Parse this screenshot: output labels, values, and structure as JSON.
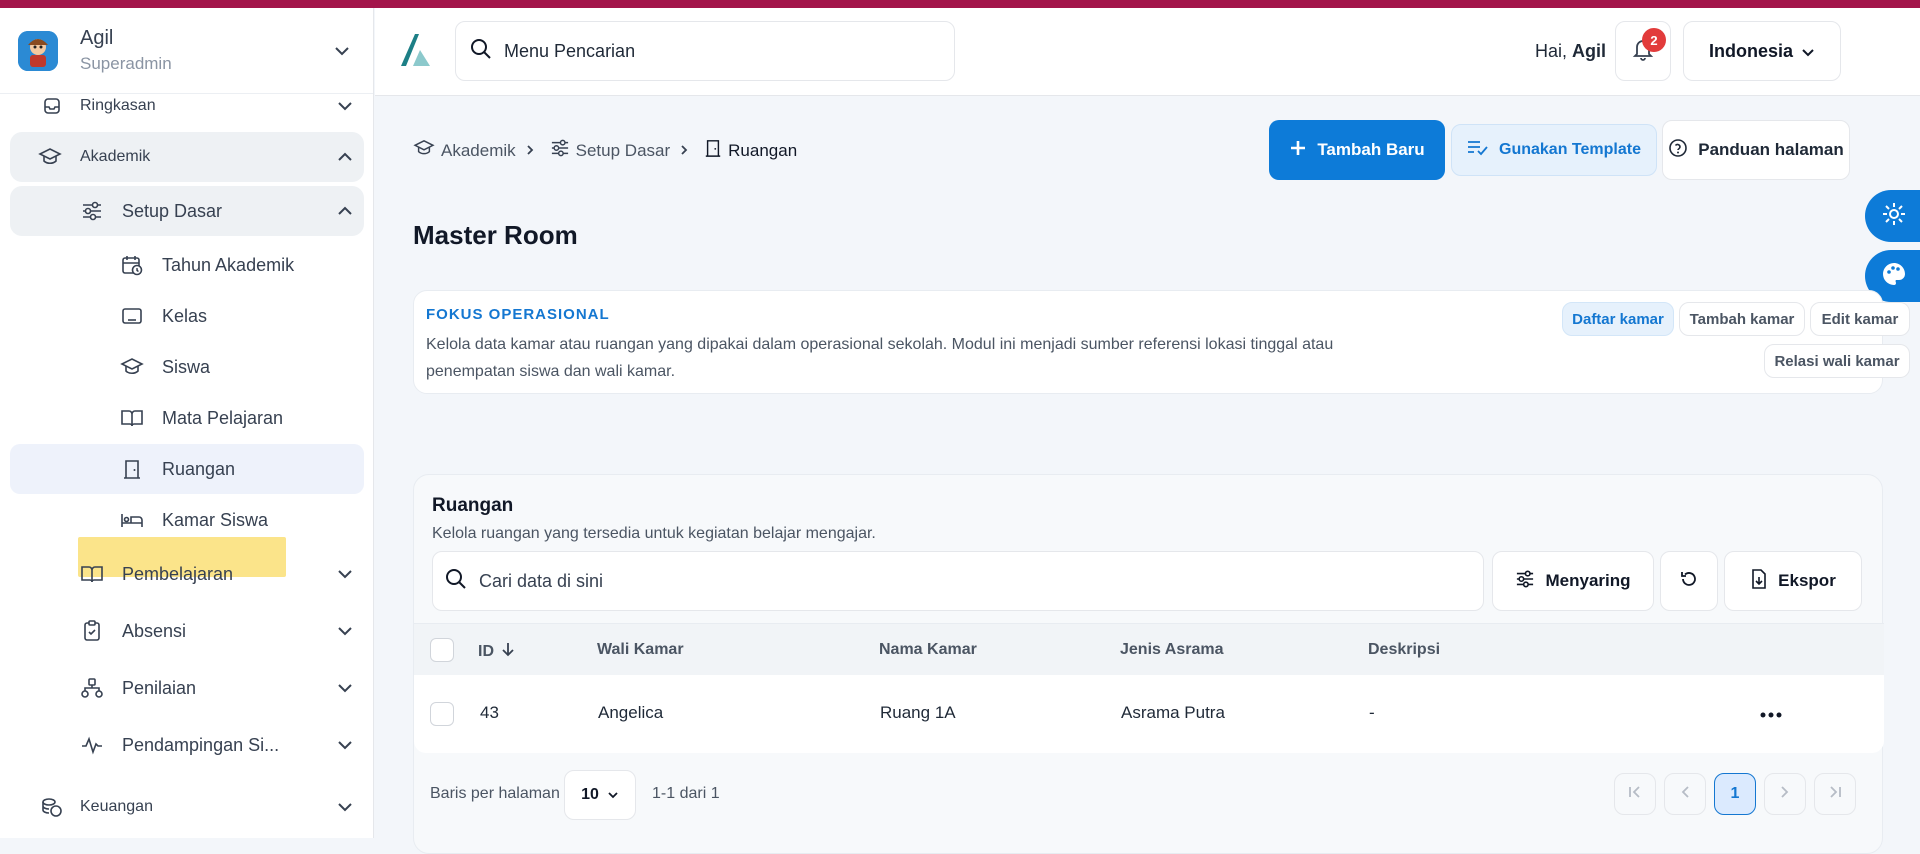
{
  "user": {
    "name": "Agil",
    "role": "Superadmin"
  },
  "sidebar": {
    "items": [
      {
        "label": "Ringkasan"
      },
      {
        "label": "Akademik"
      },
      {
        "label": "Setup Dasar"
      },
      {
        "label": "Tahun Akademik"
      },
      {
        "label": "Kelas"
      },
      {
        "label": "Siswa"
      },
      {
        "label": "Mata Pelajaran"
      },
      {
        "label": "Ruangan"
      },
      {
        "label": "Kamar Siswa"
      },
      {
        "label": "Pembelajaran"
      },
      {
        "label": "Absensi"
      },
      {
        "label": "Penilaian"
      },
      {
        "label": "Pendampingan Si..."
      },
      {
        "label": "Keuangan"
      }
    ]
  },
  "topbar": {
    "search_placeholder": "Menu Pencarian",
    "greeting": "Hai,",
    "greeting_name": "Agil",
    "notif_count": "2",
    "language": "Indonesia"
  },
  "breadcrumb": [
    "Akademik",
    "Setup Dasar",
    "Ruangan"
  ],
  "actions": {
    "add": "Tambah Baru",
    "template": "Gunakan Template",
    "guide": "Panduan halaman"
  },
  "page_title": "Master Room",
  "focus": {
    "tag": "FOKUS OPERASIONAL",
    "desc": "Kelola data kamar atau ruangan yang dipakai dalam operasional sekolah. Modul ini menjadi sumber referensi lokasi tinggal atau penempatan siswa dan wali kamar.",
    "chips": [
      "Daftar kamar",
      "Tambah kamar",
      "Edit kamar",
      "Relasi wali kamar"
    ]
  },
  "table_card": {
    "title": "Ruangan",
    "subtitle": "Kelola ruangan yang tersedia untuk kegiatan belajar mengajar.",
    "search_placeholder": "Cari data di sini",
    "filter": "Menyaring",
    "export": "Ekspor",
    "columns": [
      "ID",
      "Wali Kamar",
      "Nama Kamar",
      "Jenis Asrama",
      "Deskripsi"
    ],
    "rows": [
      [
        "43",
        "Angelica",
        "Ruang 1A",
        "Asrama Putra",
        "-"
      ]
    ],
    "per_page_label": "Baris per halaman",
    "per_page": "10",
    "range": "1-1 dari 1",
    "page": "1"
  },
  "colors": {
    "accent": "#0d7bd8",
    "topline": "#a3154a",
    "highlight": "#fbe48a",
    "badge": "#e23b3b"
  }
}
